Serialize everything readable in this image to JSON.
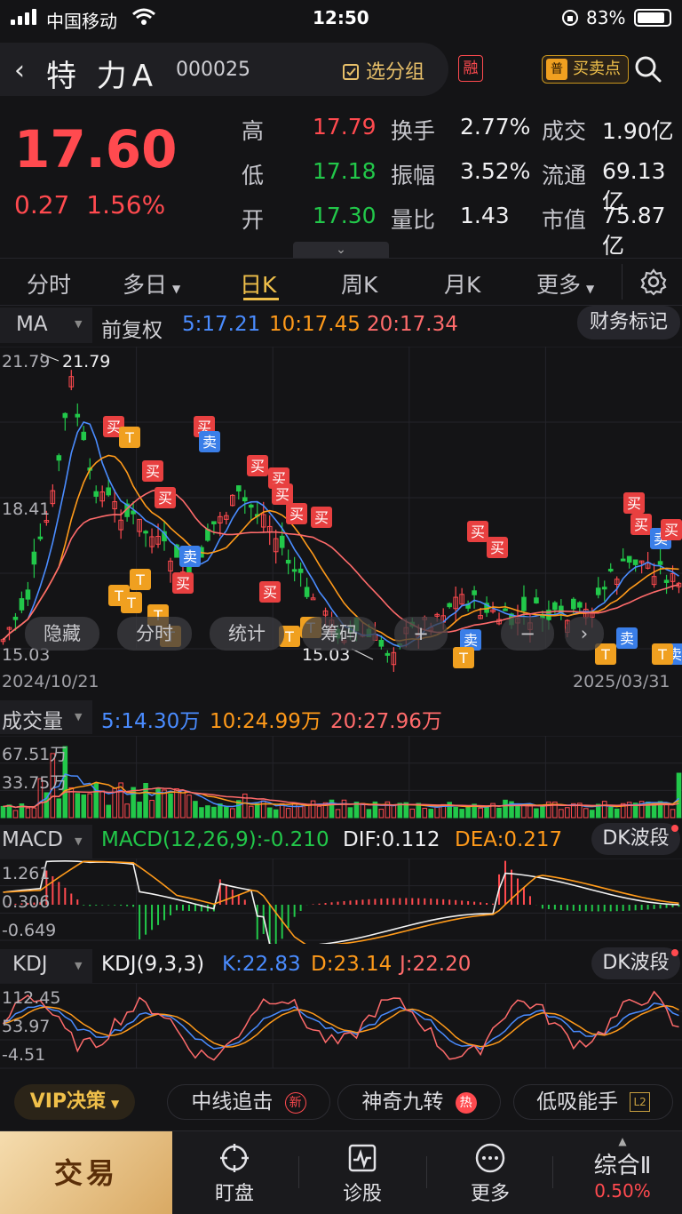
{
  "status_bar": {
    "carrier": "中国移动",
    "time": "12:50",
    "battery": "83%"
  },
  "header": {
    "stock_name": "特 力A",
    "stock_code": "000025",
    "group_button": "选分组",
    "margin_badge": "融",
    "buy_sell_badge": "普",
    "buy_sell_button": "买卖点"
  },
  "quote": {
    "price": "17.60",
    "change": "0.27",
    "change_pct": "1.56%",
    "rows": [
      [
        {
          "label": "高",
          "value": "17.79",
          "color": "red"
        },
        {
          "label": "换手",
          "value": "2.77%",
          "color": "white"
        },
        {
          "label": "成交",
          "value": "1.90亿",
          "color": "white"
        }
      ],
      [
        {
          "label": "低",
          "value": "17.18",
          "color": "green"
        },
        {
          "label": "振幅",
          "value": "3.52%",
          "color": "white"
        },
        {
          "label": "流通",
          "value": "69.13亿",
          "color": "white"
        }
      ],
      [
        {
          "label": "开",
          "value": "17.30",
          "color": "green"
        },
        {
          "label": "量比",
          "value": "1.43",
          "color": "white"
        },
        {
          "label": "市值",
          "value": "75.87亿",
          "color": "white"
        }
      ]
    ]
  },
  "tabs": [
    "分时",
    "多日",
    "日K",
    "周K",
    "月K",
    "更多"
  ],
  "active_tab": "日K",
  "kline": {
    "indicator": "MA",
    "adjust": "前复权",
    "ma5": "5:17.21",
    "ma10": "10:17.45",
    "ma20": "20:17.34",
    "finance_button": "财务标记",
    "y_high": "21.79",
    "y_mid": "18.41",
    "y_low": "15.03",
    "max_label": "21.79",
    "min_label": "15.03",
    "date_start": "2024/10/21",
    "date_end": "2025/03/31",
    "controls": [
      "隐藏",
      "分时",
      "统计",
      "筹码",
      "−"
    ],
    "markers": {
      "buy": "买",
      "sell": "卖",
      "t": "T"
    }
  },
  "volume": {
    "label": "成交量",
    "ma5": "5:14.30万",
    "ma10": "10:24.99万",
    "ma20": "20:27.96万",
    "y_high": "67.51万",
    "y_mid": "33.75万"
  },
  "macd": {
    "label": "MACD",
    "macd": "MACD(12,26,9):-0.210",
    "dif": "DIF:0.112",
    "dea": "DEA:0.217",
    "button": "DK波段",
    "y_high": "1.261",
    "y_mid": "0.306",
    "y_low": "-0.649"
  },
  "kdj": {
    "label": "KDJ",
    "params": "KDJ(9,3,3)",
    "k": "K:22.83",
    "d": "D:23.14",
    "j": "J:22.20",
    "button": "DK波段",
    "y_high": "112.45",
    "y_mid": "53.97",
    "y_low": "-4.51"
  },
  "strategy_bar": {
    "vip": "VIP决策",
    "items": [
      "中线追击",
      "神奇九转",
      "低吸能手"
    ],
    "badges": [
      "新",
      "热",
      "L2"
    ]
  },
  "nav": {
    "trade": "交易",
    "items": [
      "盯盘",
      "诊股",
      "更多"
    ],
    "index_name": "综合Ⅱ",
    "index_pct": "0.50%"
  },
  "colors": {
    "up": "#ff4a4f",
    "down": "#22c84a",
    "accent": "#f0c04a",
    "ma5": "#4a8cff",
    "ma10": "#ff9a1a",
    "ma20": "#ff6b6b"
  }
}
